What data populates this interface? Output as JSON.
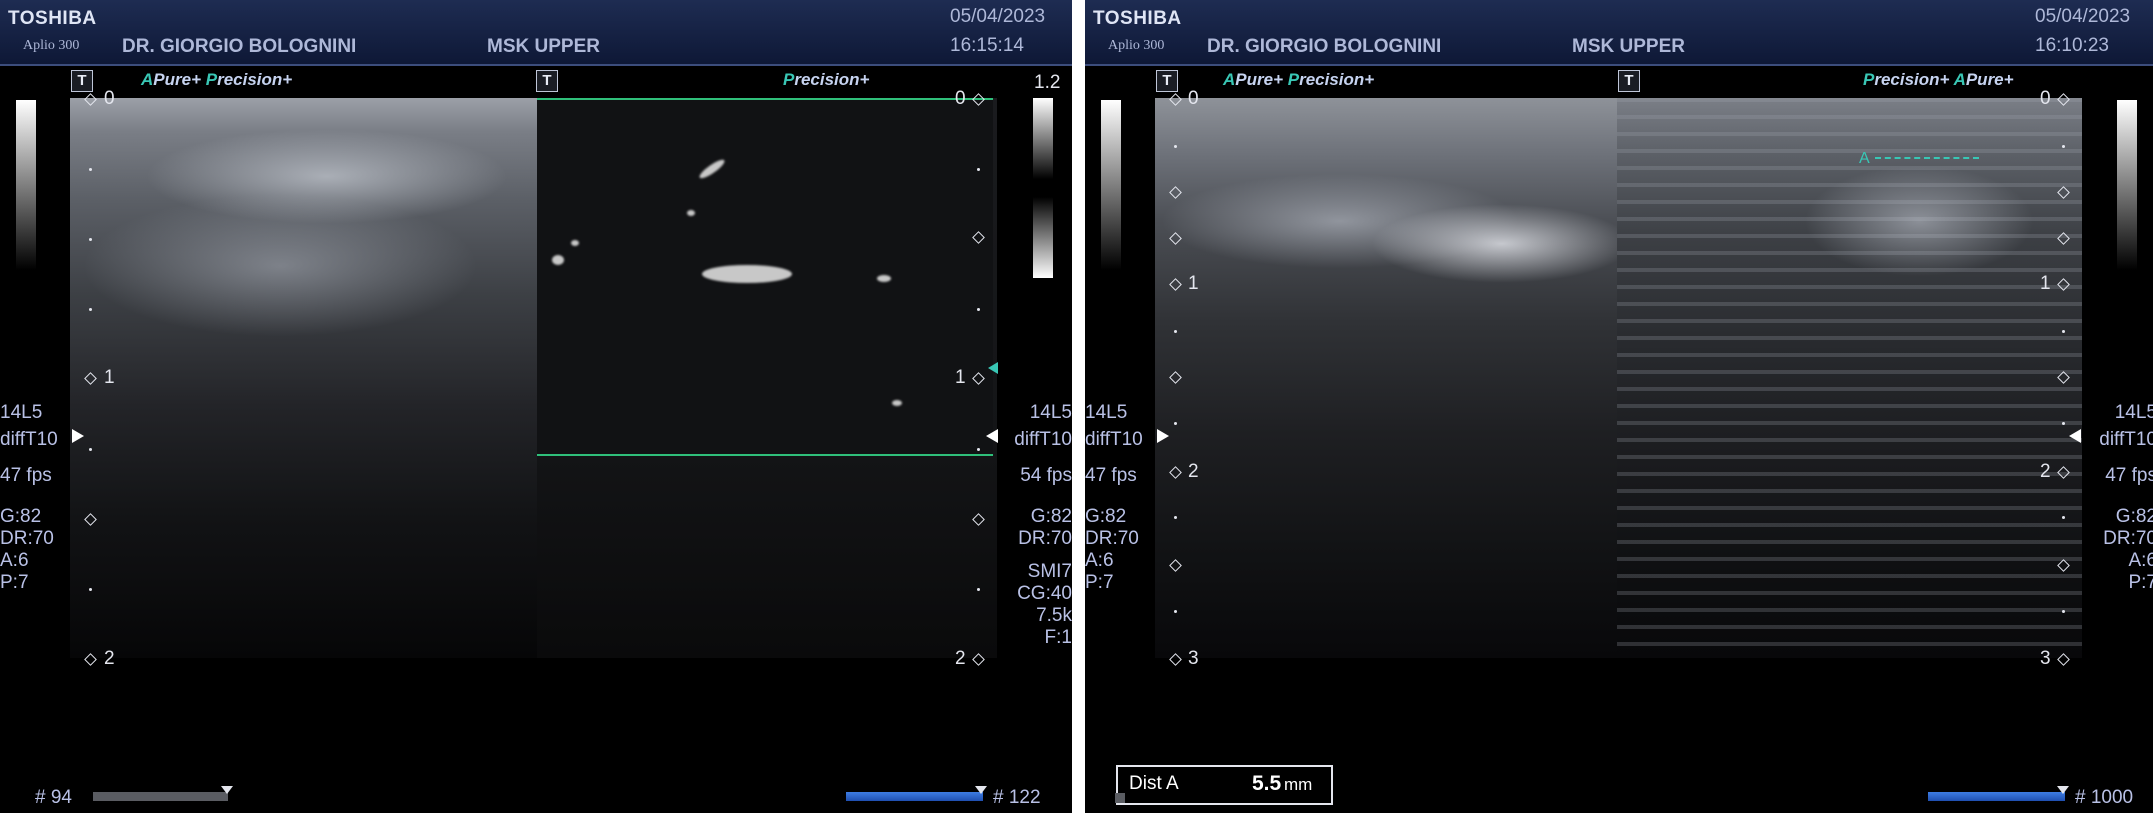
{
  "left_panel": {
    "brand": "TOSHIBA",
    "model": "Aplio 300",
    "doctor": "DR. GIORGIO BOLOGNINI",
    "preset": "MSK UPPER",
    "date": "05/04/2023",
    "time": "16:15:14",
    "mode_left": {
      "acc": "A",
      "text1": "Pure+",
      "acc2": "P",
      "text2": "recision+"
    },
    "mode_right": {
      "acc": "P",
      "text": "recision+"
    },
    "t_icon_label": "T",
    "scale_max": "1.2",
    "depth_labels_left": [
      "0",
      "1",
      "2"
    ],
    "depth_labels_right": [
      "0",
      "1",
      "2"
    ],
    "left_params": {
      "probe": "14L5",
      "filter": "diffT10",
      "fps": "47 fps",
      "gain": "G:82",
      "dr": "DR:70",
      "a": "A:6",
      "p": "P:7"
    },
    "right_params": {
      "probe": "14L5",
      "filter": "diffT10",
      "fps": "54 fps",
      "gain": "G:82",
      "dr": "DR:70",
      "mode": "SMI7",
      "cg": "CG:40",
      "prf": "7.5k",
      "f": "F:1"
    },
    "frame_left": "# 94",
    "frame_right": "# 122"
  },
  "right_panel": {
    "brand": "TOSHIBA",
    "model": "Aplio 300",
    "doctor": "DR. GIORGIO BOLOGNINI",
    "preset": "MSK UPPER",
    "date": "05/04/2023",
    "time": "16:10:23",
    "mode_left": {
      "acc": "A",
      "text1": "Pure+",
      "acc2": "P",
      "text2": "recision+"
    },
    "mode_right": {
      "acc": "P",
      "text1": "recision+",
      "acc2": "A",
      "text2": "Pure+"
    },
    "t_icon_label": "T",
    "depth_labels_left": [
      "0",
      "1",
      "2",
      "3"
    ],
    "depth_labels_right": [
      "0",
      "1",
      "2",
      "3"
    ],
    "left_params": {
      "probe": "14L5",
      "filter": "diffT10",
      "fps": "47 fps",
      "gain": "G:82",
      "dr": "DR:70",
      "a": "A:6",
      "p": "P:7"
    },
    "right_params": {
      "probe": "14L5",
      "filter": "diffT10",
      "fps": "47 fps",
      "gain": "G:82",
      "dr": "DR:70",
      "a": "A:6",
      "p": "P:7"
    },
    "caliper_label": "A",
    "measurement": {
      "label": "Dist A",
      "value": "5.5",
      "unit": "mm"
    },
    "frame_right": "# 1000"
  },
  "colors": {
    "header_text": "#aeb8d8",
    "param_text": "#b9c1e6",
    "accent_teal": "#39c7b5",
    "doppler_line": "#2fbf7a",
    "cine_blue": "#2f64cc"
  }
}
